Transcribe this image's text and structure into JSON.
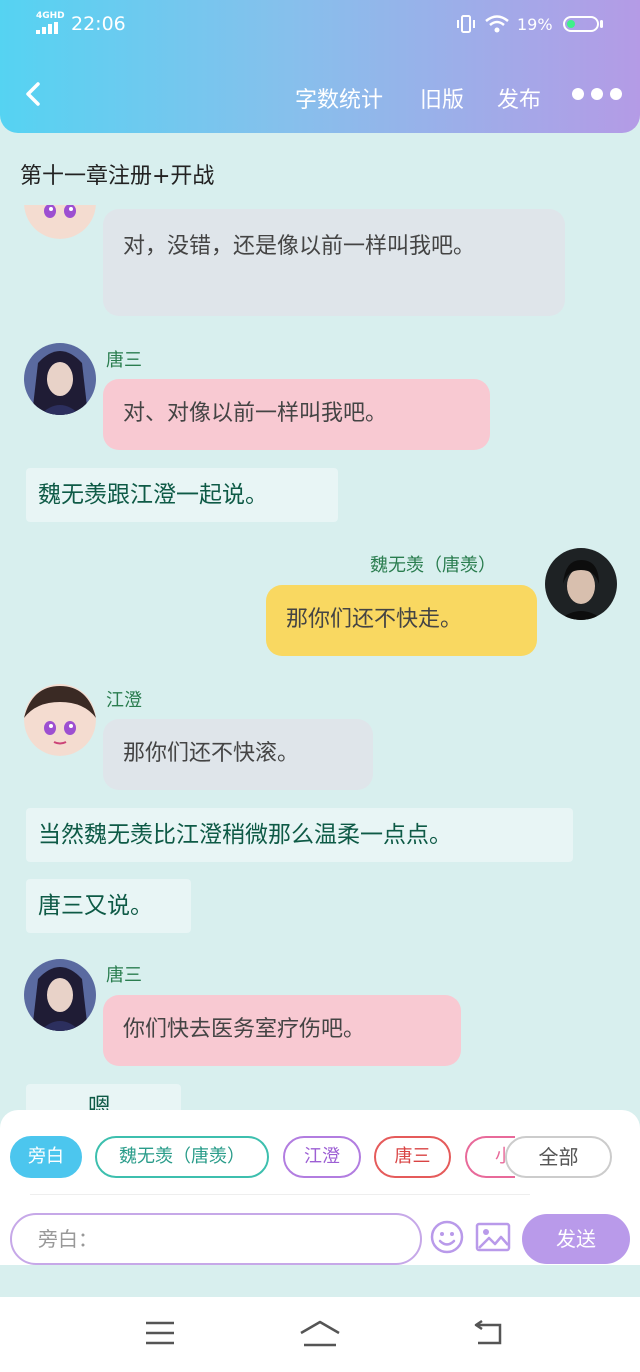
{
  "status_bar": {
    "network": "4GHD",
    "time": "22:06",
    "battery": "19%"
  },
  "header": {
    "word_count_label": "字数统计",
    "old_version_label": "旧版",
    "publish_label": "发布"
  },
  "chapter_title": "第十一章注册+开战",
  "messages": {
    "m1": {
      "text": "对，没错，还是像以前一样叫我吧。"
    },
    "m2": {
      "name": "唐三",
      "text": "对、对像以前一样叫我吧。"
    },
    "m3": {
      "text": "魏无羡跟江澄一起说。"
    },
    "m4": {
      "name": "魏无羡（唐羡）",
      "text": "那你们还不快走。"
    },
    "m5": {
      "name": "江澄",
      "text": "那你们还不快滚。"
    },
    "m6": {
      "text": "当然魏无羡比江澄稍微那么温柔一点点。"
    },
    "m7": {
      "text": "唐三又说。"
    },
    "m8": {
      "name": "唐三",
      "text": "你们快去医务室疗伤吧。"
    },
    "m9": {
      "text": "嗯"
    }
  },
  "roles": {
    "narrator": "旁白",
    "wei": "魏无羡（唐羡）",
    "jiang": "江澄",
    "tang": "唐三",
    "partial": "小",
    "all": "全部"
  },
  "composer": {
    "placeholder": "旁白：",
    "send_label": "发送"
  },
  "colors": {
    "accent": "#4cc6ee",
    "send": "#b99aea",
    "name_green": "#2a7d4f"
  }
}
